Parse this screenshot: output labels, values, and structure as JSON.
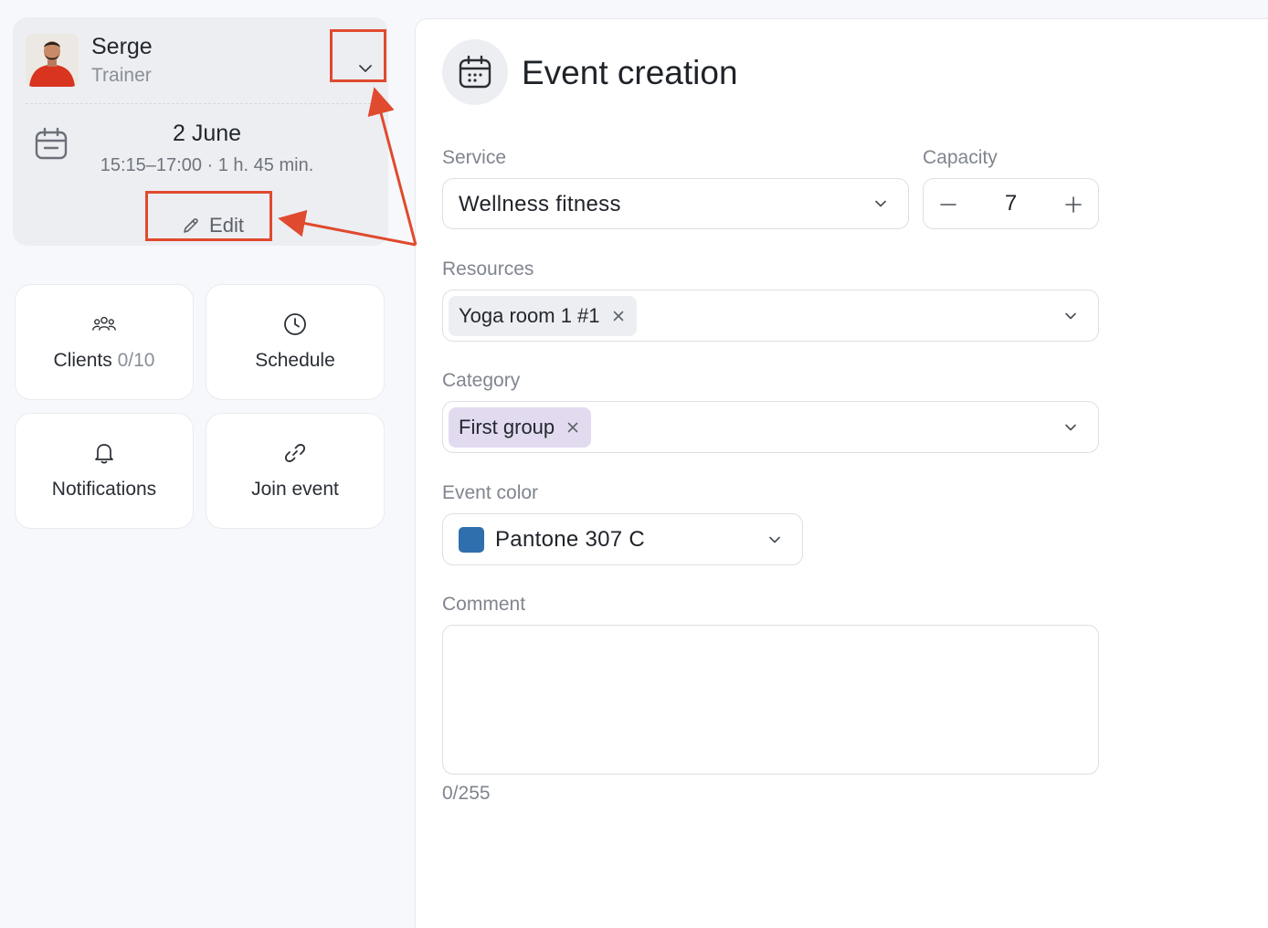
{
  "sidebar": {
    "trainer": {
      "name": "Serge",
      "role": "Trainer"
    },
    "event": {
      "date": "2 June",
      "time": "15:15–17:00 · 1 h. 45 min."
    },
    "edit_label": "Edit",
    "tiles": {
      "clients": {
        "label": "Clients",
        "count": "0/10",
        "icon": "users-icon"
      },
      "schedule": {
        "label": "Schedule",
        "icon": "clock-icon"
      },
      "notifications": {
        "label": "Notifications",
        "icon": "bell-icon"
      },
      "join": {
        "label": "Join event",
        "icon": "link-icon"
      }
    }
  },
  "form": {
    "title": "Event creation",
    "service": {
      "label": "Service",
      "value": "Wellness fitness"
    },
    "capacity": {
      "label": "Capacity",
      "value": "7"
    },
    "resources": {
      "label": "Resources",
      "chips": [
        "Yoga room 1 #1"
      ]
    },
    "category": {
      "label": "Category",
      "chips": [
        "First group"
      ],
      "chip_color": "#e2dbf0"
    },
    "event_color": {
      "label": "Event color",
      "value": "Pantone 307 C",
      "swatch": "#2f6fad"
    },
    "comment": {
      "label": "Comment",
      "value": "",
      "counter": "0/255"
    }
  },
  "colors": {
    "annotation": "#e04a2e",
    "resource_chip": "#eceef2"
  }
}
